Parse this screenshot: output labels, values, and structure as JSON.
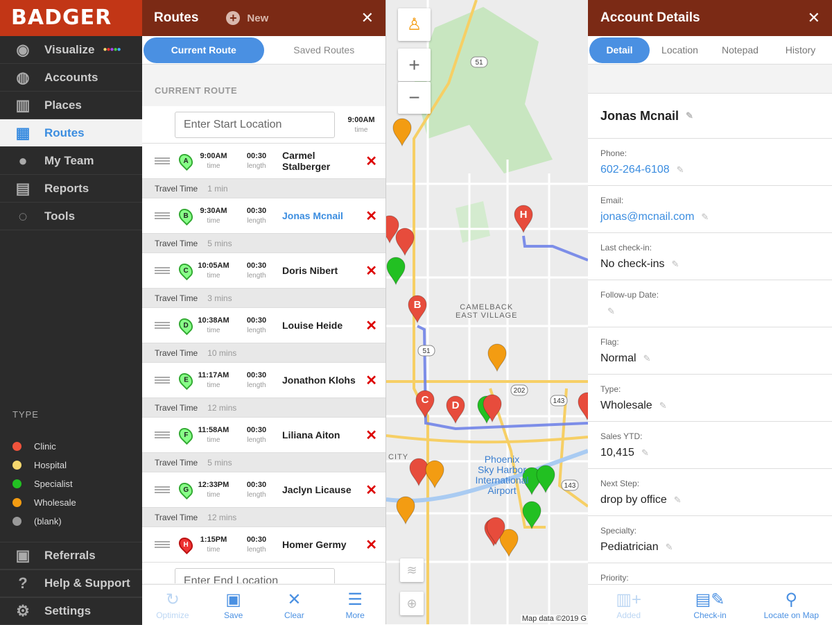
{
  "sidebar": {
    "logo": "BADGER",
    "items": [
      {
        "label": "Visualize",
        "icon": "eye-icon",
        "g": "◉"
      },
      {
        "label": "Accounts",
        "icon": "user-circle-icon",
        "g": "◍"
      },
      {
        "label": "Places",
        "icon": "storefront-icon",
        "g": "▥"
      },
      {
        "label": "Routes",
        "icon": "map-icon",
        "g": "▦"
      },
      {
        "label": "My Team",
        "icon": "team-icon",
        "g": "●"
      },
      {
        "label": "Reports",
        "icon": "report-icon",
        "g": "▤"
      },
      {
        "label": "Tools",
        "icon": "lasso-icon",
        "g": "◌"
      }
    ],
    "type_heading": "TYPE",
    "legend": [
      {
        "label": "Clinic",
        "color": "#f0533c"
      },
      {
        "label": "Hospital",
        "color": "#f5d76e"
      },
      {
        "label": "Specialist",
        "color": "#22c022"
      },
      {
        "label": "Wholesale",
        "color": "#f39c12"
      },
      {
        "label": "(blank)",
        "color": "#999999"
      }
    ],
    "bottom": [
      {
        "label": "Referrals",
        "icon": "gift-icon",
        "g": "▣"
      },
      {
        "label": "Help & Support",
        "icon": "help-icon",
        "g": "?"
      },
      {
        "label": "Settings",
        "icon": "gear-icon",
        "g": "⚙"
      }
    ]
  },
  "routes": {
    "title": "Routes",
    "new_label": "New",
    "tabs": [
      "Current Route",
      "Saved Routes"
    ],
    "section": "CURRENT ROUTE",
    "start_placeholder": "Enter Start Location",
    "start_time": "9:00AM",
    "time_label": "time",
    "length_label": "length",
    "travel_label": "Travel Time",
    "stops": [
      {
        "letter": "A",
        "time": "9:00AM",
        "length": "00:30",
        "name": "Carmel Stalberger",
        "travel": "1 min"
      },
      {
        "letter": "B",
        "time": "9:30AM",
        "length": "00:30",
        "name": "Jonas Mcnail",
        "travel": "5 mins"
      },
      {
        "letter": "C",
        "time": "10:05AM",
        "length": "00:30",
        "name": "Doris Nibert",
        "travel": "3 mins"
      },
      {
        "letter": "D",
        "time": "10:38AM",
        "length": "00:30",
        "name": "Louise Heide",
        "travel": "10 mins"
      },
      {
        "letter": "E",
        "time": "11:17AM",
        "length": "00:30",
        "name": "Jonathon Klohs",
        "travel": "12 mins"
      },
      {
        "letter": "F",
        "time": "11:58AM",
        "length": "00:30",
        "name": "Liliana Aiton",
        "travel": "5 mins"
      },
      {
        "letter": "G",
        "time": "12:33PM",
        "length": "00:30",
        "name": "Jaclyn Licause",
        "travel": "12 mins"
      },
      {
        "letter": "H",
        "time": "1:15PM",
        "length": "00:30",
        "name": "Homer Germy",
        "travel": null
      }
    ],
    "end_placeholder": "Enter End Location",
    "toolbar": [
      "Optimize",
      "Save",
      "Clear",
      "More"
    ]
  },
  "map": {
    "area_label": "CAMELBACK\nEAST VILLAGE",
    "city_label": "CITY",
    "airport": "Phoenix\nSky Harbor\nInternational\nAirport",
    "shields": [
      "51",
      "51",
      "202",
      "143",
      "143"
    ],
    "credit": "Map data ©2019 G"
  },
  "detail": {
    "title": "Account Details",
    "tabs": [
      "Detail",
      "Location",
      "Notepad",
      "History"
    ],
    "name": "Jonas Mcnail",
    "fields": [
      {
        "label": "Phone:",
        "value": "602-264-6108",
        "link": true
      },
      {
        "label": "Email:",
        "value": "jonas@mcnail.com",
        "link": true
      },
      {
        "label": "Last check-in:",
        "value": "No check-ins"
      },
      {
        "label": "Follow-up Date:",
        "value": ""
      },
      {
        "label": "Flag:",
        "value": "Normal"
      },
      {
        "label": "Type:",
        "value": "Wholesale"
      },
      {
        "label": "Sales YTD:",
        "value": "10,415"
      },
      {
        "label": "Next Step:",
        "value": "drop by office"
      },
      {
        "label": "Specialty:",
        "value": "Pediatrician"
      },
      {
        "label": "Priority:",
        "value": ""
      }
    ],
    "toolbar": [
      "Added",
      "Check-in",
      "Locate on Map"
    ]
  }
}
